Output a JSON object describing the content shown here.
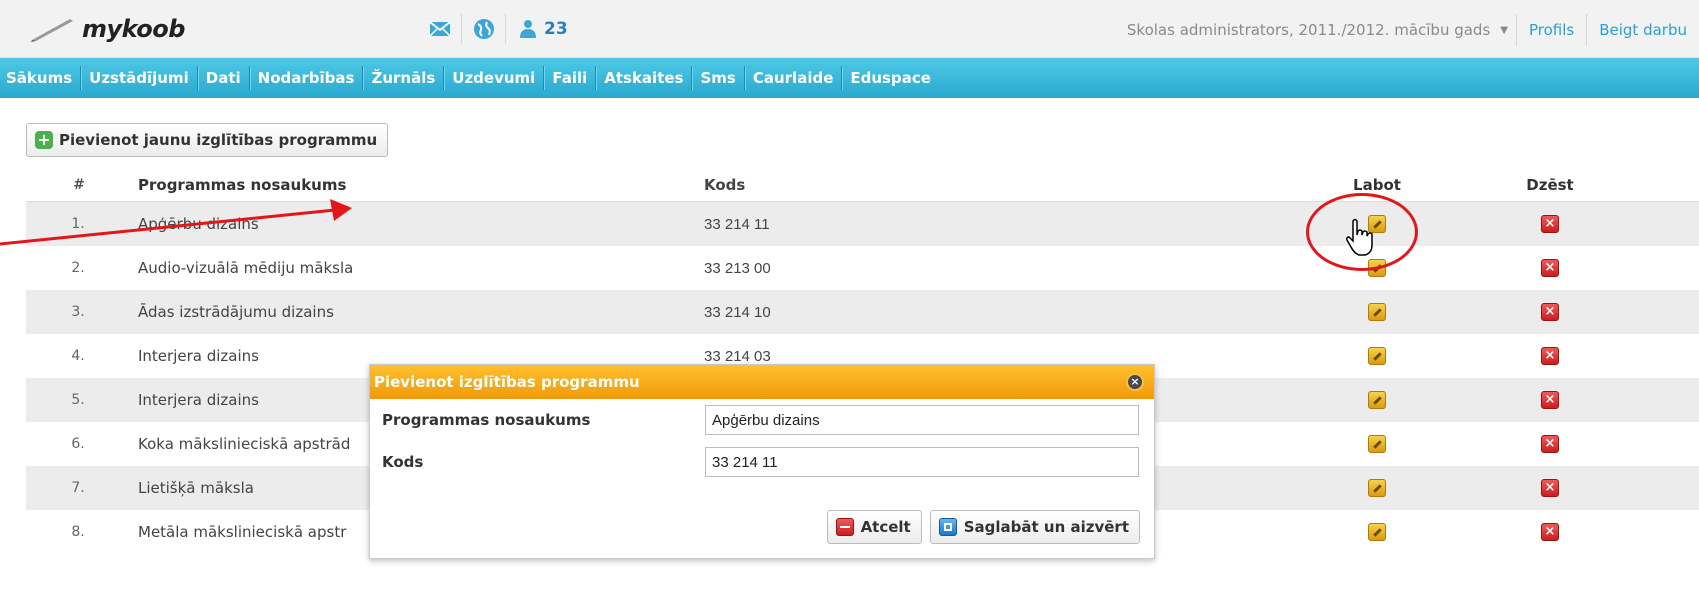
{
  "header": {
    "logo_text": "mykoob",
    "users_count": "23",
    "user_role": "Skolas administrators, 2011./2012. mācību gads",
    "profile_link": "Profils",
    "logout_link": "Beigt darbu"
  },
  "nav": {
    "items": [
      {
        "label": "Sākums"
      },
      {
        "label": "Uzstādījumi"
      },
      {
        "label": "Dati"
      },
      {
        "label": "Nodarbības"
      },
      {
        "label": "Žurnāls"
      },
      {
        "label": "Uzdevumi"
      },
      {
        "label": "Faili"
      },
      {
        "label": "Atskaites"
      },
      {
        "label": "Sms"
      },
      {
        "label": "Caurlaide"
      },
      {
        "label": "Eduspace"
      }
    ]
  },
  "toolbar": {
    "add_label": "Pievienot jaunu izglītības programmu"
  },
  "table": {
    "headers": {
      "num": "#",
      "name": "Programmas nosaukums",
      "code": "Kods",
      "edit": "Labot",
      "delete": "Dzēst"
    },
    "rows": [
      {
        "num": "1.",
        "name": "Apģērbu dizains",
        "code": "33 214 11"
      },
      {
        "num": "2.",
        "name": "Audio-vizuālā mēdiju māksla",
        "code": "33 213 00"
      },
      {
        "num": "3.",
        "name": "Ādas izstrādājumu dizains",
        "code": "33 214 10"
      },
      {
        "num": "4.",
        "name": "Interjera dizains",
        "code": "33 214 03"
      },
      {
        "num": "5.",
        "name": "Interjera dizains",
        "code": ""
      },
      {
        "num": "6.",
        "name": "Koka mākslinieciskā apstrād",
        "code": ""
      },
      {
        "num": "7.",
        "name": "Lietišķā māksla",
        "code": ""
      },
      {
        "num": "8.",
        "name": "Metāla mākslinieciskā apstr",
        "code": ""
      }
    ]
  },
  "dialog": {
    "title": "Pievienot izglītības programmu",
    "name_label": "Programmas nosaukums",
    "name_value": "Apģērbu dizains",
    "code_label": "Kods",
    "code_value": "33 214 11",
    "cancel_label": "Atcelt",
    "save_label": "Saglabāt un aizvērt"
  }
}
